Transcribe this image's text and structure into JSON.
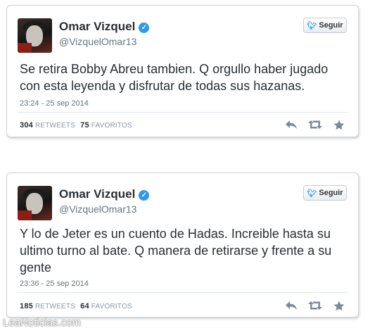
{
  "tweets": [
    {
      "name": "Omar Vizquel",
      "handle": "@VizquelOmar13",
      "follow_label": "Seguir",
      "text": "Se retira Bobby Abreu tambien. Q orgullo haber jugado con esta leyenda y disfrutar de todas sus hazanas.",
      "time": "23:24 - 25 sep 2014",
      "retweets": "304",
      "retweets_label": "RETWEETS",
      "favorites": "75",
      "favorites_label": "FAVORITOS"
    },
    {
      "name": "Omar Vizquel",
      "handle": "@VizquelOmar13",
      "follow_label": "Seguir",
      "text": "Y lo de Jeter es un cuento de Hadas. Increible hasta su ultimo turno al bate. Q manera de retirarse y frente a su gente",
      "time": "23:36 - 25 sep 2014",
      "retweets": "185",
      "retweets_label": "RETWEETS",
      "favorites": "64",
      "favorites_label": "FAVORITOS"
    }
  ],
  "icons": {
    "verified": "verified-badge-icon",
    "bird": "twitter-bird-icon",
    "reply": "reply-icon",
    "retweet": "retweet-icon",
    "favorite": "star-icon"
  },
  "colors": {
    "verified": "#2b9af0",
    "text": "#292f33",
    "muted": "#66757f",
    "icon": "#7d8a94"
  },
  "watermark": "LeaNoticias.com"
}
